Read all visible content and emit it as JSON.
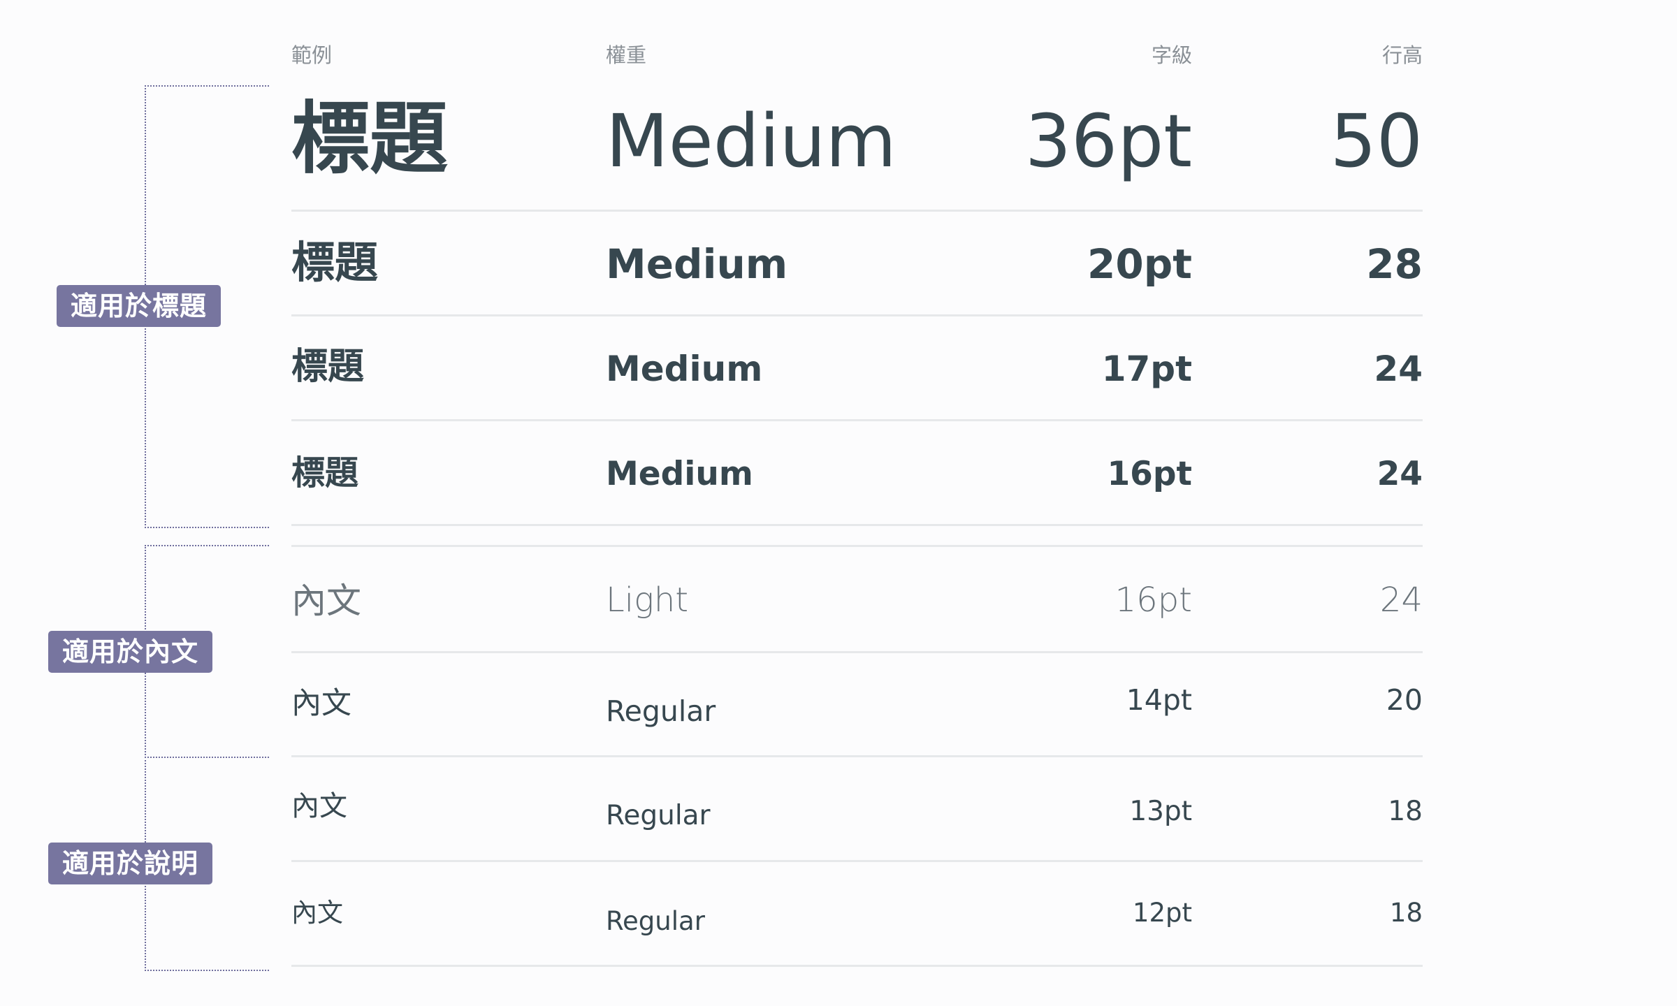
{
  "header": {
    "sample": "範例",
    "weight": "權重",
    "size": "字級",
    "line_height": "行高"
  },
  "groups": {
    "heading": "適用於標題",
    "body": "適用於內文",
    "caption": "適用於說明"
  },
  "rows": [
    {
      "sample": "標題",
      "weight": "Medium",
      "size": "36pt",
      "line_height": "50"
    },
    {
      "sample": "標題",
      "weight": "Medium",
      "size": "20pt",
      "line_height": "28"
    },
    {
      "sample": "標題",
      "weight": "Medium",
      "size": "17pt",
      "line_height": "24"
    },
    {
      "sample": "標題",
      "weight": "Medium",
      "size": "16pt",
      "line_height": "24"
    },
    {
      "sample": "內文",
      "weight": "Light",
      "size": "16pt",
      "line_height": "24"
    },
    {
      "sample": "內文",
      "weight": "Regular",
      "size": "14pt",
      "line_height": "20"
    },
    {
      "sample": "內文",
      "weight": "Regular",
      "size": "13pt",
      "line_height": "18"
    },
    {
      "sample": "內文",
      "weight": "Regular",
      "size": "12pt",
      "line_height": "18"
    }
  ],
  "colors": {
    "accent": "#77759f",
    "text": "#37474f",
    "muted": "#8a9096",
    "divider": "#e6e8ea"
  }
}
